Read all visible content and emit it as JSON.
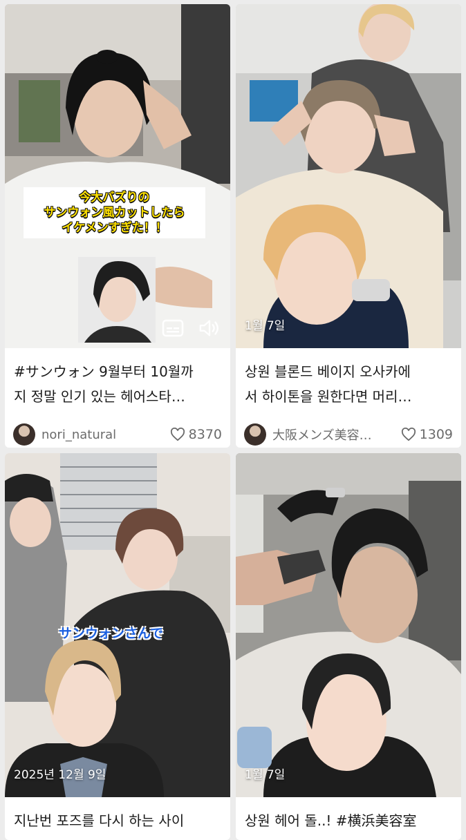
{
  "feed": {
    "cards": [
      {
        "overlay_caption": [
          "今大バズりの",
          "サンウォン風カットしたら",
          "イケメンすぎた！！"
        ],
        "caption_lines": [
          "#サンウォン 9월부터 10월까",
          "지 정말 인기 있는 헤어스타…"
        ],
        "username": "nori_natural",
        "likes": "8370",
        "icons": [
          "captions-icon",
          "volume-icon",
          "heart-icon"
        ]
      },
      {
        "date": "1월 7일",
        "caption_lines": [
          "상원 블론드 베이지 오사카에",
          "서 하이톤을 원한다면 머리…"
        ],
        "username": "大阪メンズ美容…",
        "likes": "1309",
        "icons": [
          "heart-icon"
        ]
      },
      {
        "overlay_caption": "サンウォンさんで",
        "date": "2025년 12월 9일",
        "caption_lines": [
          "지난번 포즈를 다시 하는 사이"
        ]
      },
      {
        "date": "1월 7일",
        "caption_lines": [
          "상원 헤어 돌..! #横浜美容室"
        ]
      }
    ]
  },
  "colors": {
    "card_bg": "#ffffff",
    "page_bg": "#ececec",
    "meta_text": "#6b6b6b",
    "overlay_yellow": "#ffe100",
    "overlay_blue": "#1a5fe0"
  }
}
